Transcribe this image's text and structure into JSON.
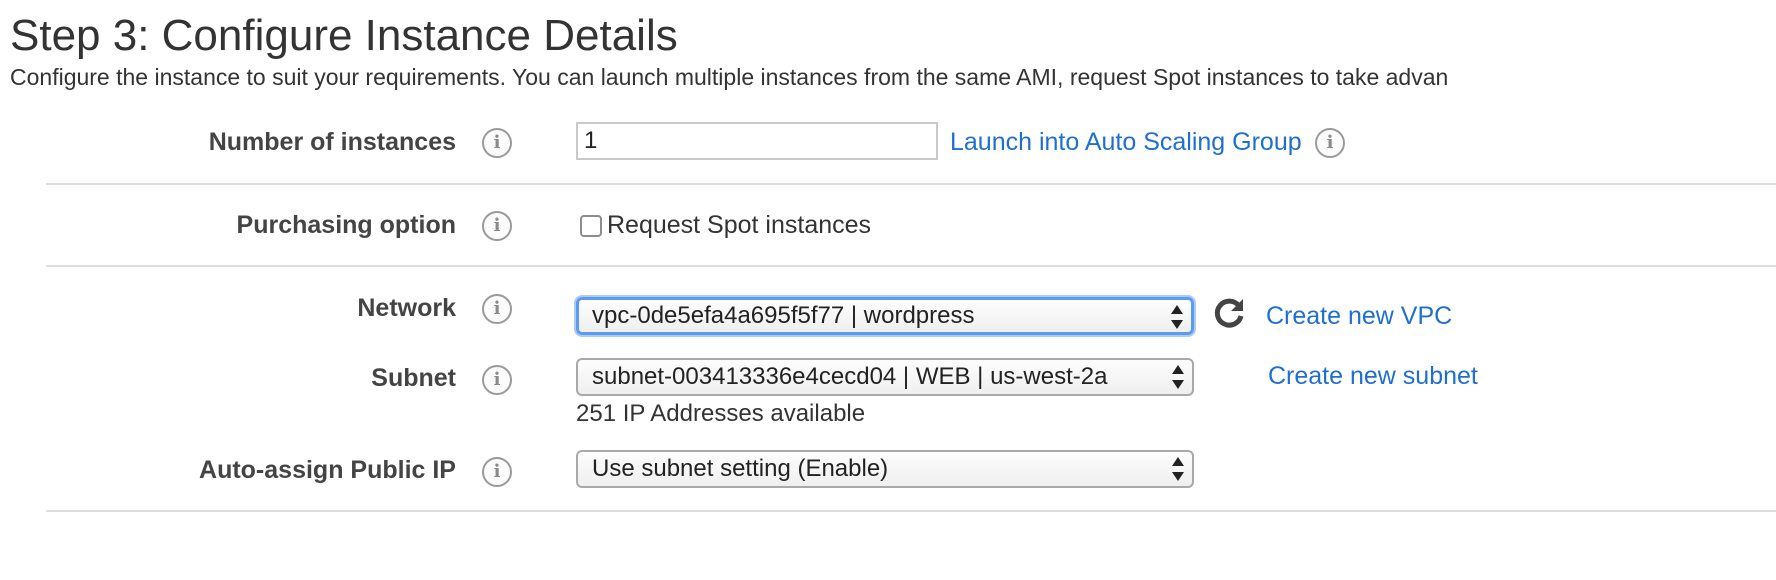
{
  "page": {
    "title": "Step 3: Configure Instance Details",
    "description": "Configure the instance to suit your requirements. You can launch multiple instances from the same AMI, request Spot instances to take advan"
  },
  "form": {
    "number_of_instances": {
      "label": "Number of instances",
      "value": "1",
      "link": "Launch into Auto Scaling Group"
    },
    "purchasing_option": {
      "label": "Purchasing option",
      "checkbox_label": "Request Spot instances",
      "checked": false
    },
    "network": {
      "label": "Network",
      "selected": "vpc-0de5efa4a695f5f77 | wordpress",
      "link": "Create new VPC"
    },
    "subnet": {
      "label": "Subnet",
      "selected": "subnet-003413336e4cecd04 | WEB | us-west-2a",
      "link": "Create new subnet",
      "available_text": "251 IP Addresses available"
    },
    "public_ip": {
      "label": "Auto-assign Public IP",
      "selected": "Use subnet setting (Enable)"
    }
  },
  "icons": {
    "info": "info-icon",
    "refresh": "refresh-icon",
    "select_arrows": "select-arrows-icon"
  },
  "colors": {
    "link": "#1f6fd0",
    "focus_ring": "#5b9bf0",
    "divider": "#dddddd",
    "label": "#444444"
  }
}
